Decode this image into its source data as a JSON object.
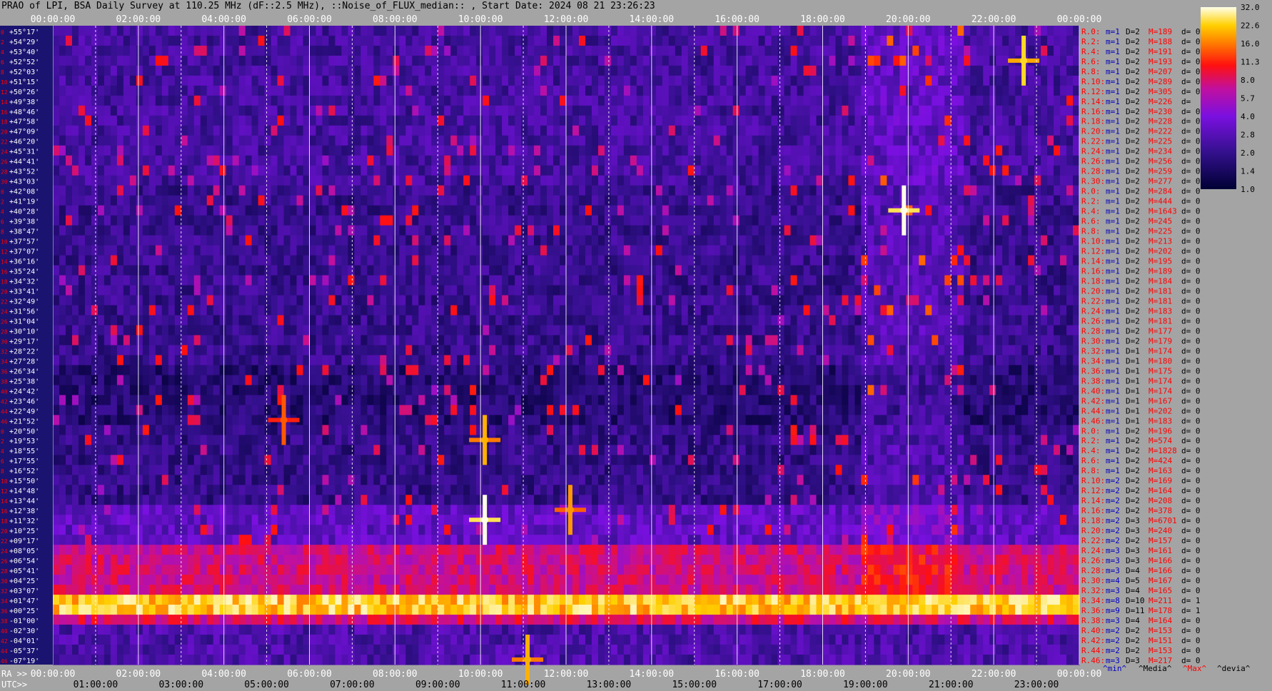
{
  "header": {
    "title": "PRAO of LPI, BSA Daily Survey at 110.25 MHz (dF::2.5 MHz), ::Noise_of_FLUX_median:: , Start Date: 2024 08 21 23:26:23"
  },
  "colors": {
    "background": "#a4a4a4",
    "ra_label": "#ff0000",
    "stat_m": "#0000c0",
    "stat_M": "#ff0000",
    "dec_text": "#ffffff",
    "dec_index": "#ff0000"
  },
  "chart_data": {
    "type": "heatmap",
    "title": "",
    "xlabel": "",
    "ylabel": "",
    "x_axis_top": {
      "ticks": [
        "00:00:00",
        "02:00:00",
        "04:00:00",
        "06:00:00",
        "08:00:00",
        "10:00:00",
        "12:00:00",
        "14:00:00",
        "16:00:00",
        "18:00:00",
        "20:00:00",
        "22:00:00",
        "00:00:00"
      ]
    },
    "x_axis_bottom_ra": {
      "label": "RA >>",
      "ticks": [
        "00:00:00",
        "02:00:00",
        "04:00:00",
        "06:00:00",
        "08:00:00",
        "10:00:00",
        "12:00:00",
        "14:00:00",
        "16:00:00",
        "18:00:00",
        "20:00:00",
        "22:00:00",
        "00:00:00"
      ]
    },
    "x_axis_bottom_utc": {
      "label": "UTC>>",
      "ticks": [
        "01:00:00",
        "03:00:00",
        "05:00:00",
        "07:00:00",
        "09:00:00",
        "11:00:00",
        "13:00:00",
        "15:00:00",
        "17:00:00",
        "19:00:00",
        "21:00:00",
        "23:00:00"
      ]
    },
    "y_axis_dec": [
      "+55°17'",
      "+54°29'",
      "+53°40'",
      "+52°52'",
      "+52°03'",
      "+51°15'",
      "+50°26'",
      "+49°38'",
      "+48°46'",
      "+47°58'",
      "+47°09'",
      "+46°20'",
      "+45°31'",
      "+44°41'",
      "+43°52'",
      "+43°03'",
      "+42°08'",
      "+41°19'",
      "+40°28'",
      "+39°38'",
      "+38°47'",
      "+37°57'",
      "+37°07'",
      "+36°16'",
      "+35°24'",
      "+34°32'",
      "+33°41'",
      "+32°49'",
      "+31°56'",
      "+31°04'",
      "+30°10'",
      "+29°17'",
      "+28°22'",
      "+27°28'",
      "+26°34'",
      "+25°38'",
      "+24°42'",
      "+23°46'",
      "+22°49'",
      "+21°52'",
      "+20°50'",
      "+19°53'",
      "+18°55'",
      "+17°55'",
      "+16°52'",
      "+15°50'",
      "+14°48'",
      "+13°44'",
      "+12°38'",
      "+11°32'",
      "+10°25'",
      "+09°17'",
      "+08°05'",
      "+06°54'",
      "+05°41'",
      "+04°25'",
      "+03°07'",
      "+01°47'",
      "+00°25'",
      "-01°00'",
      "-02°30'",
      "-04°01'",
      "-05°37'",
      "-07°19'"
    ],
    "y_axis_index": [
      "0",
      "2",
      "4",
      "6",
      "8",
      "10",
      "12",
      "14",
      "16",
      "18",
      "20",
      "22",
      "24",
      "26",
      "28",
      "30",
      "0",
      "2",
      "4",
      "6",
      "8",
      "10",
      "12",
      "14",
      "16",
      "18",
      "20",
      "22",
      "24",
      "26",
      "28",
      "30",
      "32",
      "34",
      "36",
      "38",
      "40",
      "42",
      "44",
      "46",
      "0",
      "2",
      "4",
      "6",
      "8",
      "10",
      "12",
      "14",
      "16",
      "18",
      "20",
      "22",
      "24",
      "26",
      "28",
      "30",
      "32",
      "34",
      "36",
      "38",
      "40",
      "42",
      "44",
      "46"
    ],
    "rows": [
      {
        "r": "R.0:",
        "m": "m=1",
        "D": "D=2",
        "M": "M=189",
        "d": "d= 0"
      },
      {
        "r": "R.2:",
        "m": "m=1",
        "D": "D=2",
        "M": "M=188",
        "d": "d= 0"
      },
      {
        "r": "R.4:",
        "m": "m=1",
        "D": "D=2",
        "M": "M=191",
        "d": "d= 0"
      },
      {
        "r": "R.6:",
        "m": "m=1",
        "D": "D=2",
        "M": "M=193",
        "d": "d= 0"
      },
      {
        "r": "R.8:",
        "m": "m=1",
        "D": "D=2",
        "M": "M=207",
        "d": "d= 0"
      },
      {
        "r": "R.10:",
        "m": "m=1",
        "D": "D=2",
        "M": "M=289",
        "d": "d= 0"
      },
      {
        "r": "R.12:",
        "m": "m=1",
        "D": "D=2",
        "M": "M=305",
        "d": "d= 0"
      },
      {
        "r": "R.14:",
        "m": "m=1",
        "D": "D=2",
        "M": "M=226",
        "d": "d="
      },
      {
        "r": "R.16:",
        "m": "m=1",
        "D": "D=2",
        "M": "M=230",
        "d": "d= 0"
      },
      {
        "r": "R.18:",
        "m": "m=1",
        "D": "D=2",
        "M": "M=228",
        "d": "d= 0"
      },
      {
        "r": "R.20:",
        "m": "m=1",
        "D": "D=2",
        "M": "M=222",
        "d": "d= 0"
      },
      {
        "r": "R.22:",
        "m": "m=1",
        "D": "D=2",
        "M": "M=225",
        "d": "d= 0"
      },
      {
        "r": "R.24:",
        "m": "m=1",
        "D": "D=2",
        "M": "M=234",
        "d": "d= 0"
      },
      {
        "r": "R.26:",
        "m": "m=1",
        "D": "D=2",
        "M": "M=256",
        "d": "d= 0"
      },
      {
        "r": "R.28:",
        "m": "m=1",
        "D": "D=2",
        "M": "M=259",
        "d": "d= 0"
      },
      {
        "r": "R.30:",
        "m": "m=1",
        "D": "D=2",
        "M": "M=277",
        "d": "d= 0"
      },
      {
        "r": "R.0:",
        "m": "m=1",
        "D": "D=2",
        "M": "M=284",
        "d": "d= 0"
      },
      {
        "r": "R.2:",
        "m": "m=1",
        "D": "D=2",
        "M": "M=444",
        "d": "d= 0"
      },
      {
        "r": "R.4:",
        "m": "m=1",
        "D": "D=2",
        "M": "M=1643",
        "d": "d= 0"
      },
      {
        "r": "R.6:",
        "m": "m=1",
        "D": "D=2",
        "M": "M=245",
        "d": "d= 0"
      },
      {
        "r": "R.8:",
        "m": "m=1",
        "D": "D=2",
        "M": "M=225",
        "d": "d= 0"
      },
      {
        "r": "R.10:",
        "m": "m=1",
        "D": "D=2",
        "M": "M=213",
        "d": "d= 0"
      },
      {
        "r": "R.12:",
        "m": "m=1",
        "D": "D=2",
        "M": "M=202",
        "d": "d= 0"
      },
      {
        "r": "R.14:",
        "m": "m=1",
        "D": "D=2",
        "M": "M=195",
        "d": "d= 0"
      },
      {
        "r": "R.16:",
        "m": "m=1",
        "D": "D=2",
        "M": "M=189",
        "d": "d= 0"
      },
      {
        "r": "R.18:",
        "m": "m=1",
        "D": "D=2",
        "M": "M=184",
        "d": "d= 0"
      },
      {
        "r": "R.20:",
        "m": "m=1",
        "D": "D=2",
        "M": "M=181",
        "d": "d= 0"
      },
      {
        "r": "R.22:",
        "m": "m=1",
        "D": "D=2",
        "M": "M=181",
        "d": "d= 0"
      },
      {
        "r": "R.24:",
        "m": "m=1",
        "D": "D=2",
        "M": "M=183",
        "d": "d= 0"
      },
      {
        "r": "R.26:",
        "m": "m=1",
        "D": "D=2",
        "M": "M=181",
        "d": "d= 0"
      },
      {
        "r": "R.28:",
        "m": "m=1",
        "D": "D=2",
        "M": "M=177",
        "d": "d= 0"
      },
      {
        "r": "R.30:",
        "m": "m=1",
        "D": "D=2",
        "M": "M=179",
        "d": "d= 0"
      },
      {
        "r": "R.32:",
        "m": "m=1",
        "D": "D=1",
        "M": "M=174",
        "d": "d= 0"
      },
      {
        "r": "R.34:",
        "m": "m=1",
        "D": "D=1",
        "M": "M=180",
        "d": "d= 0"
      },
      {
        "r": "R.36:",
        "m": "m=1",
        "D": "D=1",
        "M": "M=175",
        "d": "d= 0"
      },
      {
        "r": "R.38:",
        "m": "m=1",
        "D": "D=1",
        "M": "M=174",
        "d": "d= 0"
      },
      {
        "r": "R.40:",
        "m": "m=1",
        "D": "D=1",
        "M": "M=174",
        "d": "d= 0"
      },
      {
        "r": "R.42:",
        "m": "m=1",
        "D": "D=1",
        "M": "M=167",
        "d": "d= 0"
      },
      {
        "r": "R.44:",
        "m": "m=1",
        "D": "D=1",
        "M": "M=202",
        "d": "d= 0"
      },
      {
        "r": "R.46:",
        "m": "m=1",
        "D": "D=1",
        "M": "M=183",
        "d": "d= 0"
      },
      {
        "r": "R.0:",
        "m": "m=1",
        "D": "D=2",
        "M": "M=196",
        "d": "d= 0"
      },
      {
        "r": "R.2:",
        "m": "m=1",
        "D": "D=2",
        "M": "M=574",
        "d": "d= 0"
      },
      {
        "r": "R.4:",
        "m": "m=1",
        "D": "D=2",
        "M": "M=1828",
        "d": "d= 0"
      },
      {
        "r": "R.6:",
        "m": "m=1",
        "D": "D=2",
        "M": "M=424",
        "d": "d= 0"
      },
      {
        "r": "R.8:",
        "m": "m=1",
        "D": "D=2",
        "M": "M=163",
        "d": "d= 0"
      },
      {
        "r": "R.10:",
        "m": "m=2",
        "D": "D=2",
        "M": "M=169",
        "d": "d= 0"
      },
      {
        "r": "R.12:",
        "m": "m=2",
        "D": "D=2",
        "M": "M=164",
        "d": "d= 0"
      },
      {
        "r": "R.14:",
        "m": "m=2",
        "D": "D=2",
        "M": "M=208",
        "d": "d= 0"
      },
      {
        "r": "R.16:",
        "m": "m=2",
        "D": "D=2",
        "M": "M=378",
        "d": "d= 0"
      },
      {
        "r": "R.18:",
        "m": "m=2",
        "D": "D=3",
        "M": "M=6701",
        "d": "d= 0"
      },
      {
        "r": "R.20:",
        "m": "m=2",
        "D": "D=3",
        "M": "M=240",
        "d": "d= 0"
      },
      {
        "r": "R.22:",
        "m": "m=2",
        "D": "D=2",
        "M": "M=157",
        "d": "d= 0"
      },
      {
        "r": "R.24:",
        "m": "m=3",
        "D": "D=3",
        "M": "M=161",
        "d": "d= 0"
      },
      {
        "r": "R.26:",
        "m": "m=3",
        "D": "D=3",
        "M": "M=166",
        "d": "d= 0"
      },
      {
        "r": "R.28:",
        "m": "m=3",
        "D": "D=4",
        "M": "M=166",
        "d": "d= 0"
      },
      {
        "r": "R.30:",
        "m": "m=4",
        "D": "D=5",
        "M": "M=167",
        "d": "d= 0"
      },
      {
        "r": "R.32:",
        "m": "m=3",
        "D": "D=4",
        "M": "M=165",
        "d": "d= 0"
      },
      {
        "r": "R.34:",
        "m": "m=8",
        "D": "D=10",
        "M": "M=211",
        "d": "d= 1"
      },
      {
        "r": "R.36:",
        "m": "m=9",
        "D": "D=11",
        "M": "M=178",
        "d": "d= 1"
      },
      {
        "r": "R.38:",
        "m": "m=3",
        "D": "D=4",
        "M": "M=164",
        "d": "d= 0"
      },
      {
        "r": "R.40:",
        "m": "m=2",
        "D": "D=2",
        "M": "M=153",
        "d": "d= 0"
      },
      {
        "r": "R.42:",
        "m": "m=2",
        "D": "D=2",
        "M": "M=151",
        "d": "d= 0"
      },
      {
        "r": "R.44:",
        "m": "m=2",
        "D": "D=2",
        "M": "M=153",
        "d": "d= 0"
      },
      {
        "r": "R.46:",
        "m": "m=3",
        "D": "D=3",
        "M": "M=217",
        "d": "d= 0"
      }
    ],
    "stats_footer": {
      "min": "^min^",
      "median": "^Media^",
      "max": "^Max^",
      "devia": "^devia^"
    },
    "colorbar": {
      "ticks": [
        "32.0",
        "22.6",
        "16.0",
        "11.3",
        "8.0",
        "5.7",
        "4.0",
        "2.8",
        "2.0",
        "1.4",
        "1.0"
      ],
      "scale": "log",
      "range": [
        1.0,
        32.0
      ]
    },
    "features": {
      "grid": true,
      "bright_band_dec_rows": [
        57,
        58
      ],
      "point_sources": [
        {
          "ra_hours": 10.1,
          "dec_row": 49,
          "intensity": 32
        },
        {
          "ra_hours": 19.9,
          "dec_row": 18,
          "intensity": 32
        },
        {
          "ra_hours": 10.1,
          "dec_row": 41,
          "intensity": 20
        },
        {
          "ra_hours": 12.1,
          "dec_row": 48,
          "intensity": 18
        },
        {
          "ra_hours": 22.7,
          "dec_row": 3,
          "intensity": 24
        },
        {
          "ra_hours": 5.4,
          "dec_row": 39,
          "intensity": 14
        },
        {
          "ra_hours": 11.1,
          "dec_row": 63,
          "intensity": 20
        }
      ]
    }
  }
}
